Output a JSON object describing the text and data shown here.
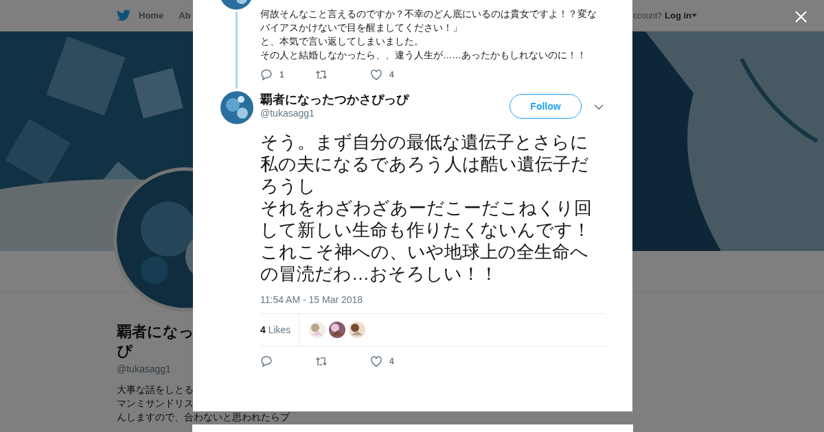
{
  "nav": {
    "home": "Home",
    "about": "Ab",
    "account": "ccount?",
    "login": "Log in"
  },
  "profile": {
    "name_lines": [
      "覇者になっ",
      "ぴ"
    ],
    "handle": "@tukasagg1",
    "bio_lines": [
      "大事な話をしとる",
      "マンミサンドリス",
      "んしますので、合わないと思われたらブ"
    ]
  },
  "modal": {
    "previous_tweet": {
      "lines": [
        "何故そんなこと言えるのですか？不幸のどん底にいるのは貴女ですよ！？変な",
        "バイアスかけないで目を醒ましてください！」",
        "と、本気で言い返してしまいました。",
        "その人と結婚しなかったら、、違う人生が……あったかもしれないのに！！"
      ],
      "reply_count": "1",
      "like_count": "4"
    },
    "tweet": {
      "name": "覇者になったつかさぴっぴ",
      "handle": "@tukasagg1",
      "follow": "Follow",
      "text_paragraphs": [
        "そう。まず自分の最低な遺伝子とさらに私の夫になるであろう人は酷い遺伝子だろうし",
        "それをわざわざあーだこーだこねくり回して新しい生命も作りたくないんです！",
        "これこそ神への、いや地球上の全生命への冒涜だわ…おそろしい！！"
      ],
      "time": "11:54 AM - 15 Mar 2018",
      "likes_count": "4",
      "likes_label": "Likes",
      "likers": [
        {
          "kind": "picture"
        },
        {
          "kind": "picture"
        },
        {
          "kind": "picture"
        }
      ],
      "like_count": "4"
    }
  }
}
